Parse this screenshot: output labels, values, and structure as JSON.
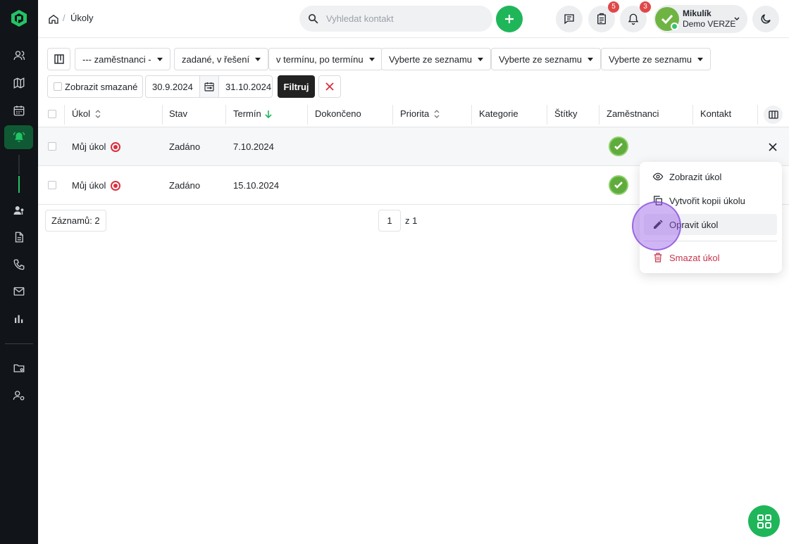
{
  "sidebar": {
    "items": [
      {
        "name": "contacts-icon"
      },
      {
        "name": "map-icon"
      },
      {
        "name": "calendar-icon"
      },
      {
        "name": "bell-icon",
        "active": true
      },
      {
        "name": "user-task-icon"
      },
      {
        "name": "document-icon"
      },
      {
        "name": "phone-icon"
      },
      {
        "name": "mail-icon"
      },
      {
        "name": "chart-icon"
      },
      {
        "name": "folder-icon"
      },
      {
        "name": "user-settings-icon"
      }
    ]
  },
  "header": {
    "breadcrumb_title": "Úkoly",
    "search_placeholder": "Vyhledat kontakt",
    "tasks_badge": "5",
    "notifications_badge": "3",
    "user_name": "Mikulík",
    "user_org": "Demo VERZE"
  },
  "filters": {
    "employees": "--- zaměstnanci -",
    "state": "zadané, v řešení",
    "term": "v termínu, po termínu",
    "select_1": "Vyberte ze seznamu",
    "select_2": "Vyberte ze seznamu",
    "select_3": "Vyberte ze seznamu",
    "show_deleted": "Zobrazit smazané",
    "date_from": "30.9.2024",
    "date_to": "31.10.2024",
    "filter_button": "Filtruj"
  },
  "table": {
    "columns": [
      "Úkol",
      "Stav",
      "Termín",
      "Dokončeno",
      "Priorita",
      "Kategorie",
      "Štítky",
      "Zaměstnanci",
      "Kontakt"
    ],
    "rows": [
      {
        "task": "Můj úkol",
        "state": "Zadáno",
        "term": "7.10.2024"
      },
      {
        "task": "Můj úkol",
        "state": "Zadáno",
        "term": "15.10.2024"
      }
    ],
    "count_label": "Záznamů: 2",
    "page": "1",
    "page_of": "z 1"
  },
  "context_menu": {
    "view": "Zobrazit úkol",
    "copy": "Vytvořit kopii úkolu",
    "edit": "Opravit úkol",
    "delete": "Smazat úkol"
  },
  "colors": {
    "accent": "#1fb65a",
    "sidebar_bg": "#111418",
    "danger": "#c8334a"
  }
}
